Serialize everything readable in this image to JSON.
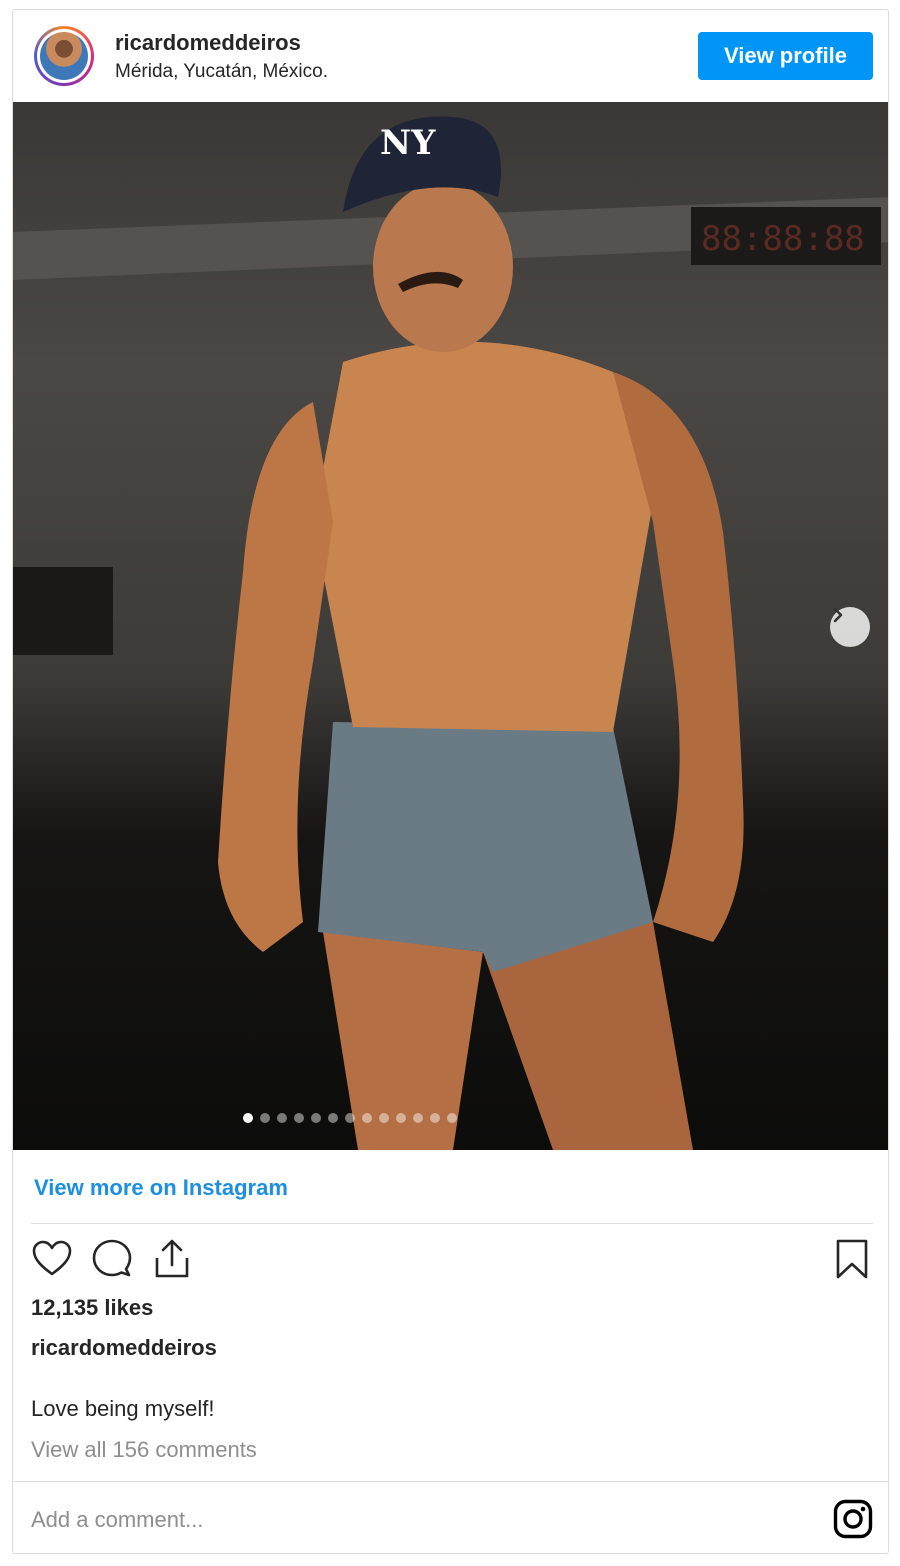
{
  "header": {
    "username": "ricardomeddeiros",
    "location": "Mérida, Yucatán, México.",
    "view_profile_label": "View profile"
  },
  "photo": {
    "carousel_count": 13,
    "carousel_active_index": 0
  },
  "links": {
    "view_more_label": "View more on Instagram"
  },
  "actions": {
    "icons": [
      "heart-icon",
      "comment-icon",
      "share-icon",
      "bookmark-icon"
    ]
  },
  "post": {
    "likes": "12,135 likes",
    "caption_user": "ricardomeddeiros",
    "caption": "Love being myself!",
    "view_comments": "View all 156 comments"
  },
  "comment": {
    "placeholder": "Add a comment..."
  },
  "colors": {
    "accent": "#0095f6",
    "link": "#1d8fe0",
    "text": "#262626",
    "muted": "#8e8e8e",
    "border": "#dbdbdb"
  }
}
